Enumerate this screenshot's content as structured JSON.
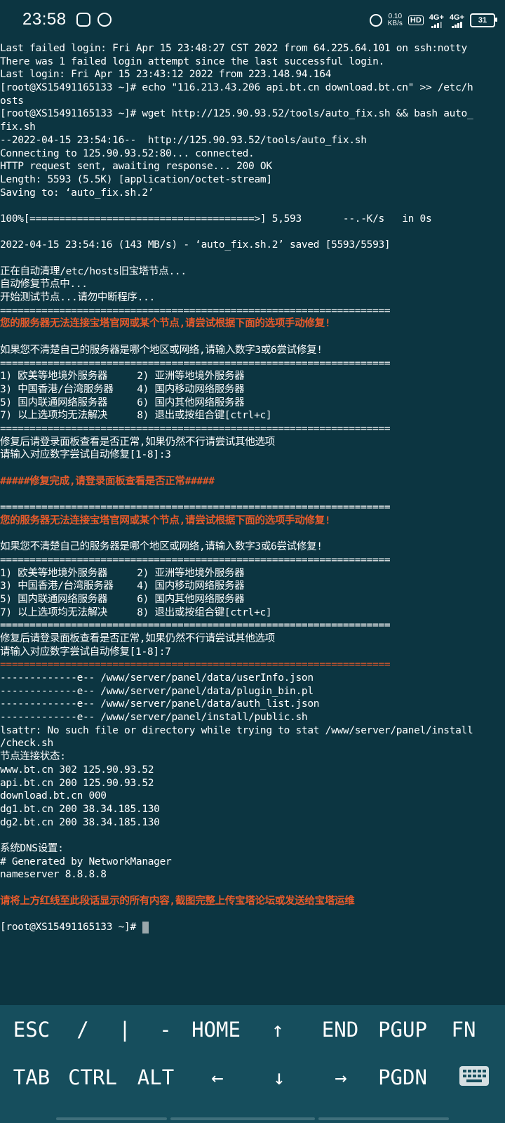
{
  "status_bar": {
    "time": "23:58",
    "net_speed_value": "0.10",
    "net_speed_unit": "KB/s",
    "hd_label": "HD",
    "hd_sub": "1 2",
    "signal1": "4G+",
    "signal2": "4G+",
    "battery": "31"
  },
  "terminal": {
    "lines": [
      {
        "text": "Last failed login: Fri Apr 15 23:48:27 CST 2022 from 64.225.64.101 on ssh:notty",
        "style": "normal"
      },
      {
        "text": "There was 1 failed login attempt since the last successful login.",
        "style": "normal"
      },
      {
        "text": "Last login: Fri Apr 15 23:43:12 2022 from 223.148.94.164",
        "style": "normal"
      },
      {
        "text": "[root@XS15491165133 ~]# echo \"116.213.43.206 api.bt.cn download.bt.cn\" >> /etc/h",
        "style": "normal"
      },
      {
        "text": "osts",
        "style": "normal"
      },
      {
        "text": "[root@XS15491165133 ~]# wget http://125.90.93.52/tools/auto_fix.sh && bash auto_",
        "style": "normal"
      },
      {
        "text": "fix.sh",
        "style": "normal"
      },
      {
        "text": "--2022-04-15 23:54:16--  http://125.90.93.52/tools/auto_fix.sh",
        "style": "normal"
      },
      {
        "text": "Connecting to 125.90.93.52:80... connected.",
        "style": "normal"
      },
      {
        "text": "HTTP request sent, awaiting response... 200 OK",
        "style": "normal"
      },
      {
        "text": "Length: 5593 (5.5K) [application/octet-stream]",
        "style": "normal"
      },
      {
        "text": "Saving to: ‘auto_fix.sh.2’",
        "style": "normal"
      },
      {
        "text": "",
        "style": "normal"
      },
      {
        "text": "100%[======================================>] 5,593       --.-K/s   in 0s",
        "style": "normal"
      },
      {
        "text": "",
        "style": "normal"
      },
      {
        "text": "2022-04-15 23:54:16 (143 MB/s) - ‘auto_fix.sh.2’ saved [5593/5593]",
        "style": "normal"
      },
      {
        "text": "",
        "style": "normal"
      },
      {
        "text": "正在自动清理/etc/hosts旧宝塔节点...",
        "style": "normal"
      },
      {
        "text": "自动修复节点中...",
        "style": "normal"
      },
      {
        "text": "开始测试节点...请勿中断程序...",
        "style": "normal"
      },
      {
        "text": "==================================================================",
        "style": "normal"
      },
      {
        "text": "您的服务器无法连接宝塔官网或某个节点,请尝试根据下面的选项手动修复!",
        "style": "red"
      },
      {
        "text": "",
        "style": "normal"
      },
      {
        "text": "如果您不清楚自己的服务器是哪个地区或网络,请输入数字3或6尝试修复!",
        "style": "normal"
      },
      {
        "text": "==================================================================",
        "style": "normal"
      },
      {
        "text": "1) 欧美等地境外服务器     2) 亚洲等地境外服务器",
        "style": "normal"
      },
      {
        "text": "3) 中国香港/台湾服务器    4) 国内移动网络服务器",
        "style": "normal"
      },
      {
        "text": "5) 国内联通网络服务器     6) 国内其他网络服务器",
        "style": "normal"
      },
      {
        "text": "7) 以上选项均无法解决     8) 退出或按组合键[ctrl+c]",
        "style": "normal"
      },
      {
        "text": "==================================================================",
        "style": "normal"
      },
      {
        "text": "修复后请登录面板查看是否正常,如果仍然不行请尝试其他选项",
        "style": "normal"
      },
      {
        "text": "请输入对应数字尝试自动修复[1-8]:3",
        "style": "normal"
      },
      {
        "text": "",
        "style": "normal"
      },
      {
        "text": "#####修复完成,请登录面板查看是否正常#####",
        "style": "red"
      },
      {
        "text": "",
        "style": "normal"
      },
      {
        "text": "==================================================================",
        "style": "normal"
      },
      {
        "text": "您的服务器无法连接宝塔官网或某个节点,请尝试根据下面的选项手动修复!",
        "style": "red"
      },
      {
        "text": "",
        "style": "normal"
      },
      {
        "text": "如果您不清楚自己的服务器是哪个地区或网络,请输入数字3或6尝试修复!",
        "style": "normal"
      },
      {
        "text": "==================================================================",
        "style": "normal"
      },
      {
        "text": "1) 欧美等地境外服务器     2) 亚洲等地境外服务器",
        "style": "normal"
      },
      {
        "text": "3) 中国香港/台湾服务器    4) 国内移动网络服务器",
        "style": "normal"
      },
      {
        "text": "5) 国内联通网络服务器     6) 国内其他网络服务器",
        "style": "normal"
      },
      {
        "text": "7) 以上选项均无法解决     8) 退出或按组合键[ctrl+c]",
        "style": "normal"
      },
      {
        "text": "==================================================================",
        "style": "normal"
      },
      {
        "text": "修复后请登录面板查看是否正常,如果仍然不行请尝试其他选项",
        "style": "normal"
      },
      {
        "text": "请输入对应数字尝试自动修复[1-8]:7",
        "style": "normal"
      },
      {
        "text": "==================================================================",
        "style": "sepred"
      },
      {
        "text": "-------------e-- /www/server/panel/data/userInfo.json",
        "style": "normal"
      },
      {
        "text": "-------------e-- /www/server/panel/data/plugin_bin.pl",
        "style": "normal"
      },
      {
        "text": "-------------e-- /www/server/panel/data/auth_list.json",
        "style": "normal"
      },
      {
        "text": "-------------e-- /www/server/panel/install/public.sh",
        "style": "normal"
      },
      {
        "text": "lsattr: No such file or directory while trying to stat /www/server/panel/install",
        "style": "normal"
      },
      {
        "text": "/check.sh",
        "style": "normal"
      },
      {
        "text": "节点连接状态:",
        "style": "normal"
      },
      {
        "text": "www.bt.cn 302 125.90.93.52",
        "style": "normal"
      },
      {
        "text": "api.bt.cn 200 125.90.93.52",
        "style": "normal"
      },
      {
        "text": "download.bt.cn 000",
        "style": "normal"
      },
      {
        "text": "dg1.bt.cn 200 38.34.185.130",
        "style": "normal"
      },
      {
        "text": "dg2.bt.cn 200 38.34.185.130",
        "style": "normal"
      },
      {
        "text": "",
        "style": "normal"
      },
      {
        "text": "系统DNS设置:",
        "style": "normal"
      },
      {
        "text": "# Generated by NetworkManager",
        "style": "normal"
      },
      {
        "text": "nameserver 8.8.8.8",
        "style": "normal"
      },
      {
        "text": "",
        "style": "normal"
      },
      {
        "text": "请将上方红线至此段话显示的所有内容,截图完整上传宝塔论坛或发送给宝塔运维",
        "style": "red"
      },
      {
        "text": "",
        "style": "normal"
      }
    ],
    "prompt": "[root@XS15491165133 ~]# "
  },
  "extra_keys": {
    "row1": [
      "ESC",
      "/",
      "|",
      "-",
      "HOME",
      "↑",
      "END",
      "PGUP",
      "FN"
    ],
    "row2": [
      "TAB",
      "CTRL",
      "ALT",
      "←",
      "↓",
      "→",
      "PGDN"
    ]
  },
  "colors": {
    "background": "#0c3541",
    "text": "#ffffff",
    "accent_red": "#e65a2b",
    "keybar": "#164e5d"
  }
}
